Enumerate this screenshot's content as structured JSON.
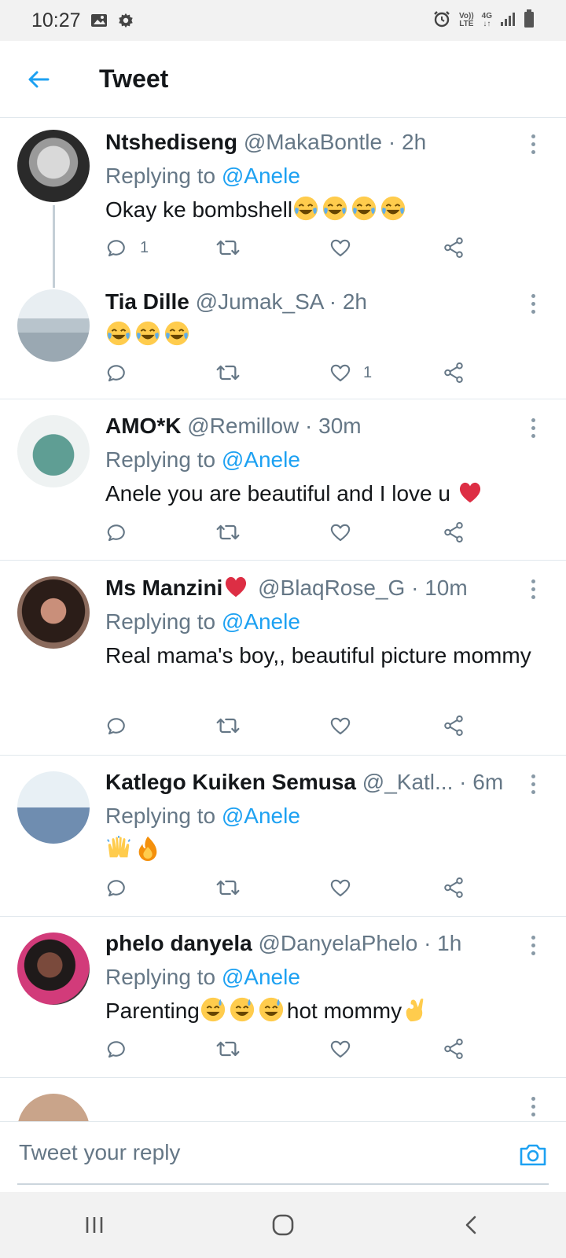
{
  "status_bar": {
    "time": "10:27",
    "network_volte": "Vo))",
    "network_lte": "LTE",
    "network_type": "4G",
    "icons": [
      "image-icon",
      "gear-icon",
      "alarm-icon",
      "signal-icon",
      "battery-icon"
    ]
  },
  "header": {
    "title": "Tweet",
    "back_icon": "back-arrow-icon"
  },
  "colors": {
    "accent": "#1da1f2",
    "secondary_text": "#657786",
    "heart_red": "#e0245e",
    "divider": "#e1e8ed"
  },
  "tweets": [
    {
      "name": "Ntshediseng",
      "handle": "@MakaBontle",
      "separator": "·",
      "time": "2h",
      "replying_label": "Replying to",
      "replying_to": "@Anele",
      "text": "Okay ke bombshell",
      "emojis": [
        "joy-emoji",
        "joy-emoji",
        "joy-emoji",
        "joy-emoji"
      ],
      "reply_count": "1",
      "retweet_count": "",
      "like_count": ""
    },
    {
      "name": "Tia Dille",
      "handle": "@Jumak_SA",
      "separator": "·",
      "time": "2h",
      "text": "",
      "emojis": [
        "joy-emoji",
        "joy-emoji",
        "joy-emoji"
      ],
      "reply_count": "",
      "retweet_count": "",
      "like_count": "1"
    },
    {
      "name": "AMO*K",
      "handle": "@Remillow",
      "separator": "·",
      "time": "30m",
      "replying_label": "Replying to",
      "replying_to": "@Anele",
      "text": "Anele you are beautiful and I love u",
      "emojis": [
        "red-heart-emoji"
      ],
      "reply_count": "",
      "retweet_count": "",
      "like_count": ""
    },
    {
      "name": "Ms Manzini",
      "handle": "@BlaqRose_G",
      "separator": "·",
      "time": "10m",
      "replying_label": "Replying to",
      "replying_to": "@Anele",
      "text": "Real mama's boy,, beautiful picture mommy",
      "name_emojis": [
        "red-heart-emoji"
      ],
      "reply_count": "",
      "retweet_count": "",
      "like_count": ""
    },
    {
      "name": "Katlego Kuiken Semusa",
      "handle": "@_Katl...",
      "separator": "·",
      "time": "6m",
      "replying_label": "Replying to",
      "replying_to": "@Anele",
      "text": "",
      "emojis": [
        "raising-hands-emoji",
        "fire-emoji"
      ],
      "reply_count": "",
      "retweet_count": "",
      "like_count": ""
    },
    {
      "name": "phelo danyela",
      "handle": "@DanyelaPhelo",
      "separator": "·",
      "time": "1h",
      "replying_label": "Replying to",
      "replying_to": "@Anele",
      "text_before": "Parenting",
      "text_after": "hot mommy",
      "emojis": [
        "sweat-smile-emoji",
        "sweat-smile-emoji",
        "sweat-smile-emoji"
      ],
      "trailing_emojis": [
        "ok-hand-emoji"
      ],
      "reply_count": "",
      "retweet_count": "",
      "like_count": ""
    }
  ],
  "reply_bar": {
    "placeholder": "Tweet your reply",
    "camera_icon": "camera-icon"
  },
  "nav_bar": {
    "icons": [
      "recent-apps-icon",
      "home-icon",
      "back-icon"
    ]
  }
}
